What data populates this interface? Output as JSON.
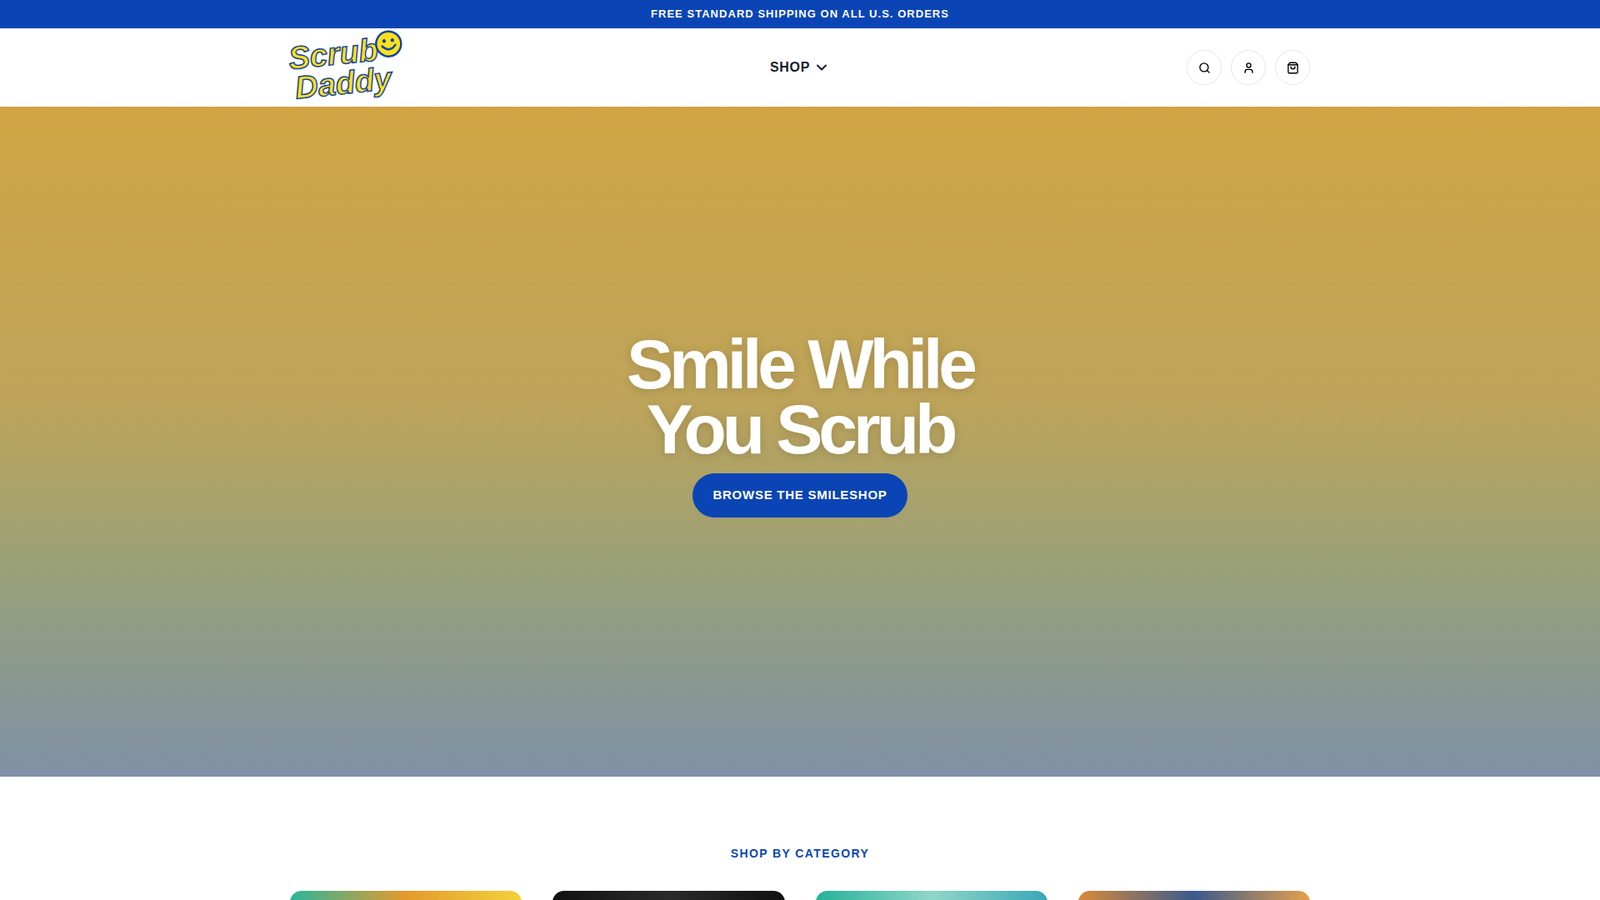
{
  "announcement": "FREE STANDARD SHIPPING ON ALL U.S. ORDERS",
  "logo": {
    "lines": [
      "Scrub",
      "Daddy"
    ]
  },
  "nav": [
    {
      "label": "SHOP",
      "expanded": false
    }
  ],
  "hero": {
    "headline": [
      "Smile While",
      "You Scrub"
    ],
    "button": "BROWSE THE SMILESHOP"
  },
  "categories": {
    "title": "SHOP BY CATEGORY"
  }
}
